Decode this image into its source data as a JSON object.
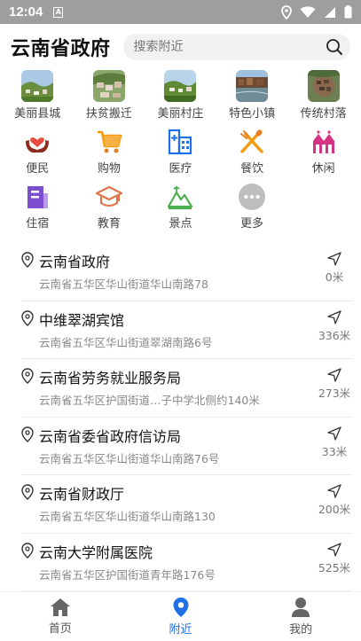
{
  "status": {
    "time": "12:04",
    "sim_label": "A"
  },
  "header": {
    "title": "云南省政府",
    "search_placeholder": "搜索附近"
  },
  "photo_categories": [
    {
      "label": "美丽县城"
    },
    {
      "label": "扶贫搬迁"
    },
    {
      "label": "美丽村庄"
    },
    {
      "label": "特色小镇"
    },
    {
      "label": "传统村落"
    }
  ],
  "icon_categories": [
    {
      "label": "便民",
      "icon": "hands-heart-icon",
      "color": "#c0392b"
    },
    {
      "label": "购物",
      "icon": "cart-icon",
      "color": "#f39c12"
    },
    {
      "label": "医疗",
      "icon": "hospital-icon",
      "color": "#1e6fe8"
    },
    {
      "label": "餐饮",
      "icon": "utensils-icon",
      "color": "#f39c12"
    },
    {
      "label": "休闲",
      "icon": "leisure-icon",
      "color": "#d63384"
    },
    {
      "label": "住宿",
      "icon": "hotel-icon",
      "color": "#7b4fcf"
    },
    {
      "label": "教育",
      "icon": "graduation-cap-icon",
      "color": "#e0774a"
    },
    {
      "label": "景点",
      "icon": "mountain-icon",
      "color": "#4caf50"
    },
    {
      "label": "更多",
      "icon": "more-icon",
      "color": "#bdbdbd"
    }
  ],
  "pois": [
    {
      "name": "云南省政府",
      "address": "云南省五华区华山街道华山南路78",
      "distance": "0米"
    },
    {
      "name": "中维翠湖宾馆",
      "address": "云南省五华区华山街道翠湖南路6号",
      "distance": "336米"
    },
    {
      "name": "云南省劳务就业服务局",
      "address": "云南省五华区护国街道…子中学北侧约140米",
      "distance": "273米"
    },
    {
      "name": "云南省委省政府信访局",
      "address": "云南省五华区华山街道华山南路76号",
      "distance": "33米"
    },
    {
      "name": "云南省财政厅",
      "address": "云南省五华区华山街道华山南路130",
      "distance": "200米"
    },
    {
      "name": "云南大学附属医院",
      "address": "云南省五华区护国街道青年路176号",
      "distance": "525米"
    }
  ],
  "tabs": [
    {
      "label": "首页",
      "icon": "home-icon"
    },
    {
      "label": "附近",
      "icon": "location-icon"
    },
    {
      "label": "我的",
      "icon": "user-icon"
    }
  ],
  "colors": {
    "accent": "#1e6fe8",
    "tab_inactive": "#666666",
    "statusbar": "#9e9e9e"
  }
}
